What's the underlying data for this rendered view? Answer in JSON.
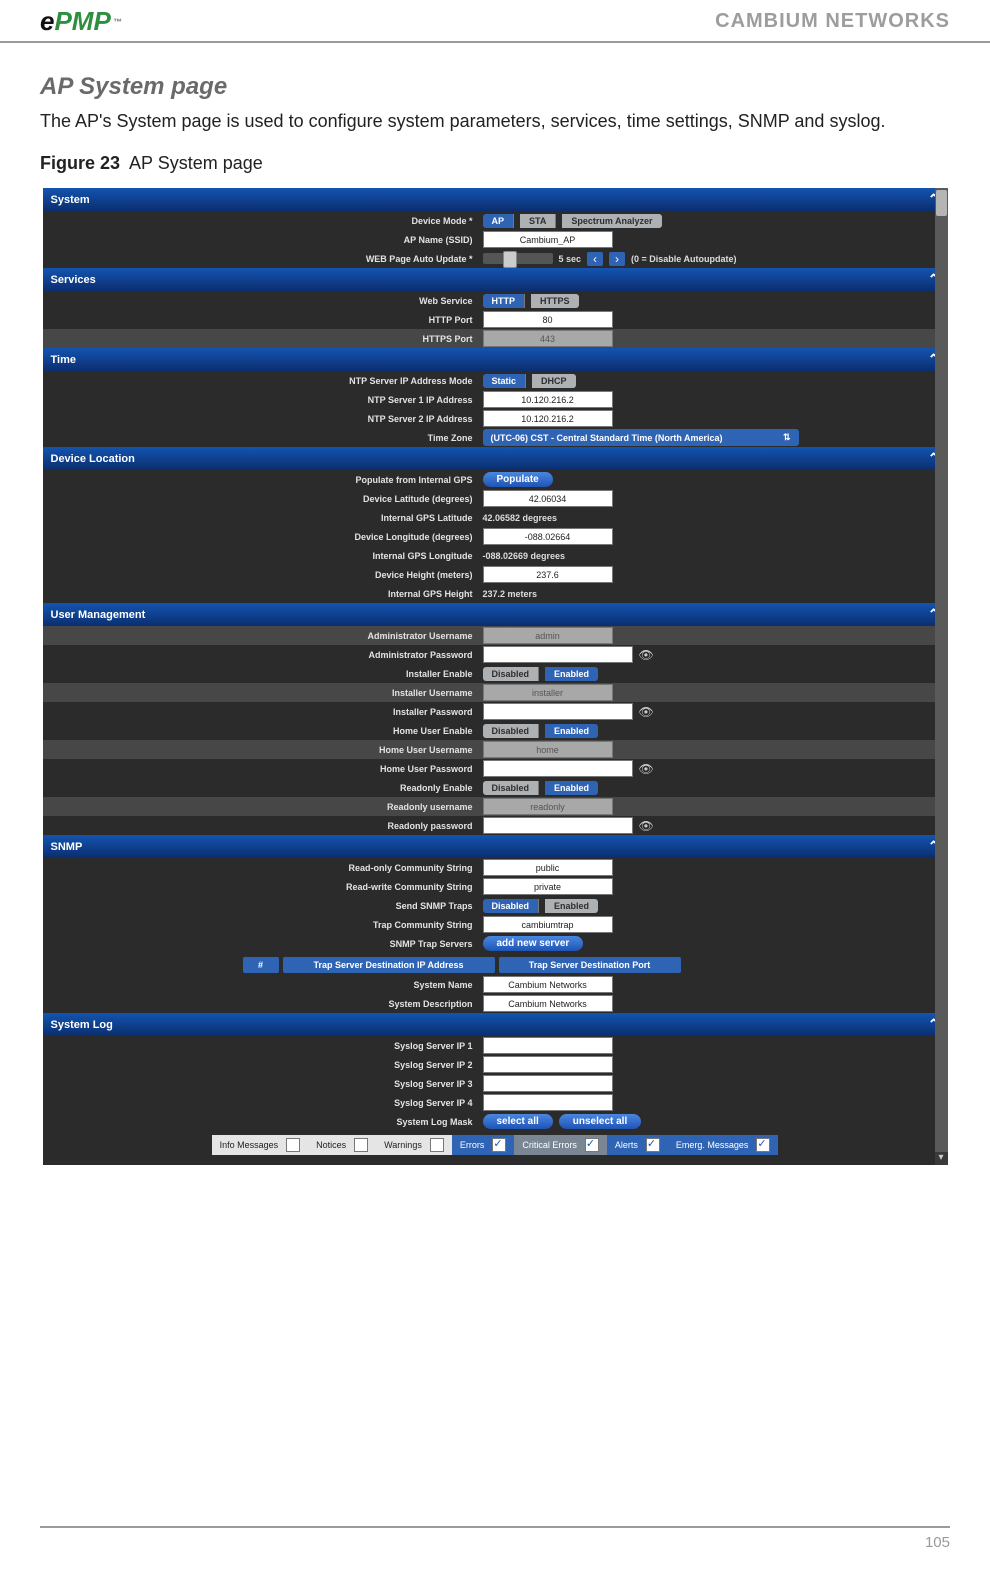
{
  "header": {
    "brand_e": "e",
    "brand_p": "PMP",
    "tm": "™",
    "company": "CAMBIUM NETWORKS"
  },
  "doc": {
    "title": "AP System page",
    "intro": "The AP's System page is used to configure system parameters, services, time settings, SNMP and syslog.",
    "figure_label": "Figure 23",
    "figure_caption": "AP System page"
  },
  "ui": {
    "panels": {
      "system": "System",
      "services": "Services",
      "time": "Time",
      "device_location": "Device Location",
      "user_mgmt": "User Management",
      "snmp": "SNMP",
      "system_log": "System Log"
    },
    "system": {
      "device_mode_label": "Device Mode *",
      "device_mode_options": [
        "AP",
        "STA",
        "Spectrum Analyzer"
      ],
      "device_mode_sel": "AP",
      "ap_name_label": "AP Name (SSID)",
      "ap_name_value": "Cambium_AP",
      "auto_update_label": "WEB Page Auto Update *",
      "auto_update_value": "5 sec",
      "auto_update_hint": "(0 = Disable Autoupdate)"
    },
    "services": {
      "web_service_label": "Web Service",
      "web_service_options": [
        "HTTP",
        "HTTPS"
      ],
      "web_service_sel": "HTTP",
      "http_port_label": "HTTP Port",
      "http_port_value": "80",
      "https_port_label": "HTTPS Port",
      "https_port_value": "443"
    },
    "time": {
      "mode_label": "NTP Server IP Address Mode",
      "mode_options": [
        "Static",
        "DHCP"
      ],
      "mode_sel": "Static",
      "s1_label": "NTP Server 1 IP Address",
      "s1_value": "10.120.216.2",
      "s2_label": "NTP Server 2 IP Address",
      "s2_value": "10.120.216.2",
      "tz_label": "Time Zone",
      "tz_value": "(UTC-06) CST - Central Standard Time (North America)"
    },
    "location": {
      "populate_label": "Populate from Internal GPS",
      "populate_btn": "Populate",
      "lat_label": "Device Latitude (degrees)",
      "lat_value": "42.06034",
      "gps_lat_label": "Internal GPS Latitude",
      "gps_lat_value": "42.06582 degrees",
      "lon_label": "Device Longitude (degrees)",
      "lon_value": "-088.02664",
      "gps_lon_label": "Internal GPS Longitude",
      "gps_lon_value": "-088.02669 degrees",
      "height_label": "Device Height (meters)",
      "height_value": "237.6",
      "gps_height_label": "Internal GPS Height",
      "gps_height_value": "237.2 meters"
    },
    "users": {
      "admin_user_label": "Administrator Username",
      "admin_user_value": "admin",
      "admin_pw_label": "Administrator Password",
      "inst_enable_label": "Installer Enable",
      "enable_options": [
        "Disabled",
        "Enabled"
      ],
      "enable_sel": "Enabled",
      "inst_user_label": "Installer Username",
      "inst_user_value": "installer",
      "inst_pw_label": "Installer Password",
      "home_enable_label": "Home User Enable",
      "home_user_label": "Home User Username",
      "home_user_value": "home",
      "home_pw_label": "Home User Password",
      "ro_enable_label": "Readonly Enable",
      "ro_user_label": "Readonly username",
      "ro_user_value": "readonly",
      "ro_pw_label": "Readonly password"
    },
    "snmp": {
      "ro_comm_label": "Read-only Community String",
      "ro_comm_value": "public",
      "rw_comm_label": "Read-write Community String",
      "rw_comm_value": "private",
      "traps_label": "Send SNMP Traps",
      "traps_options": [
        "Disabled",
        "Enabled"
      ],
      "traps_sel": "Disabled",
      "trap_comm_label": "Trap Community String",
      "trap_comm_value": "cambiumtrap",
      "trap_servers_label": "SNMP Trap Servers",
      "add_server_btn": "add new server",
      "tbl_num": "#",
      "tbl_ip": "Trap Server Destination IP Address",
      "tbl_port": "Trap Server Destination Port",
      "sysname_label": "System Name",
      "sysname_value": "Cambium Networks",
      "sysdesc_label": "System Description",
      "sysdesc_value": "Cambium Networks"
    },
    "syslog": {
      "s1_label": "Syslog Server IP 1",
      "s2_label": "Syslog Server IP 2",
      "s3_label": "Syslog Server IP 3",
      "s4_label": "Syslog Server IP 4",
      "mask_label": "System Log Mask",
      "select_all": "select all",
      "unselect_all": "unselect all",
      "cats": [
        {
          "name": "Info Messages",
          "checked": false,
          "style": "light"
        },
        {
          "name": "Notices",
          "checked": false,
          "style": "light"
        },
        {
          "name": "Warnings",
          "checked": false,
          "style": "light"
        },
        {
          "name": "Errors",
          "checked": true,
          "style": "dark"
        },
        {
          "name": "Critical Errors",
          "checked": true,
          "style": "mid"
        },
        {
          "name": "Alerts",
          "checked": true,
          "style": "dark"
        },
        {
          "name": "Emerg. Messages",
          "checked": true,
          "style": "dark"
        }
      ]
    }
  },
  "footer": {
    "page_number": "105"
  }
}
